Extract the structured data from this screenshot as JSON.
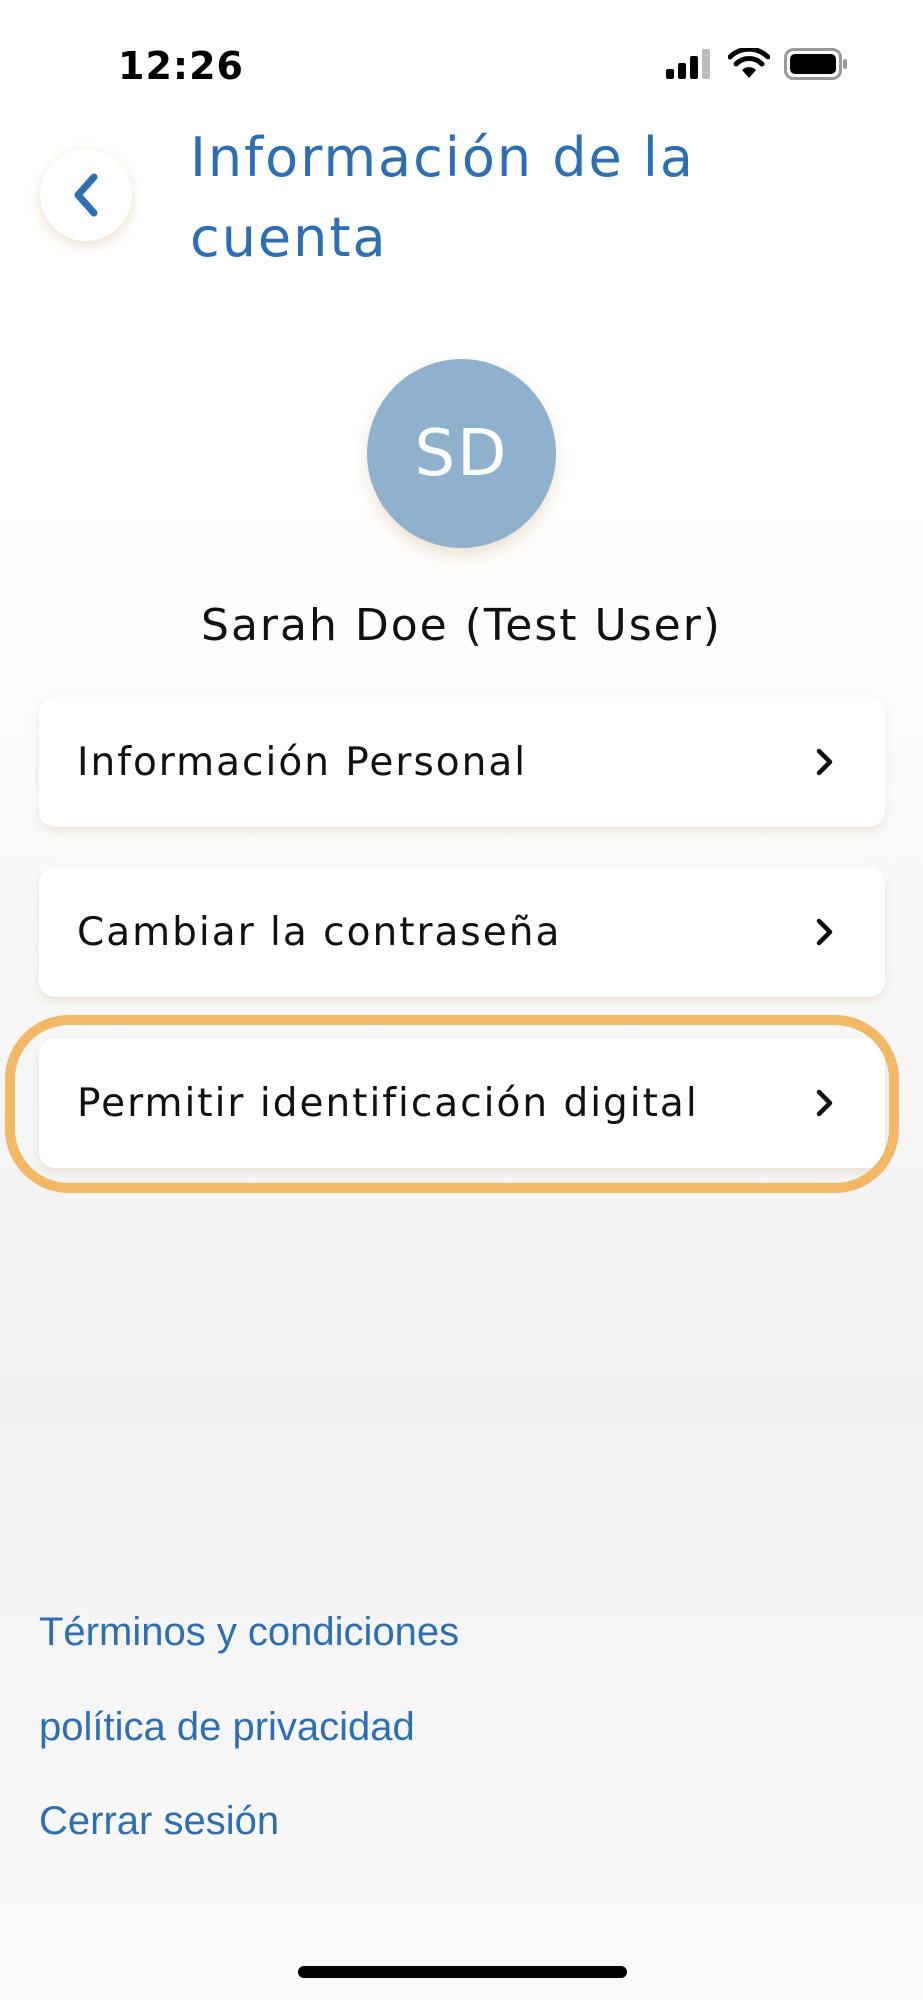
{
  "status_bar": {
    "time": "12:26",
    "icons": [
      "cellular-signal-icon",
      "wifi-icon",
      "battery-icon"
    ]
  },
  "header": {
    "title": "Información de la cuenta",
    "back_icon": "chevron-left-icon"
  },
  "profile": {
    "initials": "SD",
    "name": "Sarah Doe (Test User)"
  },
  "menu": {
    "items": [
      {
        "label": "Información Personal",
        "icon": "chevron-right-icon"
      },
      {
        "label": "Cambiar la contraseña",
        "icon": "chevron-right-icon"
      },
      {
        "label": "Permitir identificación digital",
        "icon": "chevron-right-icon"
      }
    ]
  },
  "footer": {
    "terms": "Términos y condiciones",
    "privacy": "política de privacidad",
    "logout": "Cerrar sesión"
  },
  "colors": {
    "accent": "#2e6fb4",
    "avatar": "#90b1ce",
    "highlight": "#f2b866"
  }
}
